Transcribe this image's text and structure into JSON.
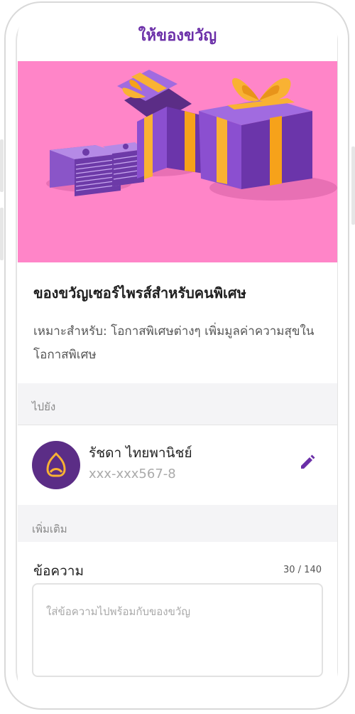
{
  "header": {
    "title": "ให้ของขวัญ"
  },
  "gift": {
    "title": "ของขวัญเซอร์ไพรส์สำหรับคนพิเศษ",
    "description": "เหมาะสำหรับ: โอกาสพิเศษต่างๆ เพิ่มมูลค่าความสุขใน โอกาสพิเศษ"
  },
  "recipient_section": {
    "label": "ไปยัง"
  },
  "recipient": {
    "name": "รัชดา ไทยพานิชย์",
    "account": "xxx-xxx567-8",
    "edit_icon": "pencil-icon",
    "bank_icon": "scb-bank-logo"
  },
  "extra_section": {
    "label": "เพิ่มเติม"
  },
  "message": {
    "label": "ข้อความ",
    "counter": "30 / 140",
    "placeholder": "ใส่ข้อความไปพร้อมกับของขวัญ"
  },
  "colors": {
    "accent": "#6b2fa8",
    "banner_bg": "#ff85c8",
    "gift_box": "#7c3fc0",
    "ribbon": "#f9b233",
    "avatar_bg": "#5b2d86"
  }
}
